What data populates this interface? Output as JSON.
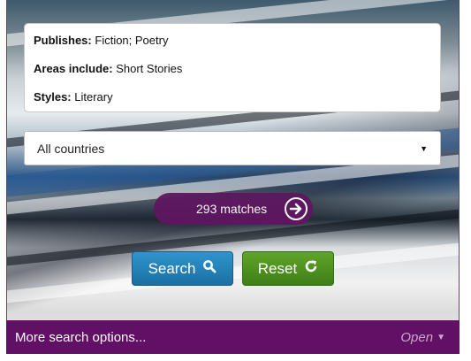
{
  "filters": {
    "publishes_label": "Publishes:",
    "publishes_value": "Fiction; Poetry",
    "areas_label": "Areas include:",
    "areas_value": "Short Stories",
    "styles_label": "Styles:",
    "styles_value": "Literary"
  },
  "country_select": {
    "value": "All countries",
    "icon": "chevron-down-icon"
  },
  "matches": {
    "label": "293 matches",
    "icon": "arrow-right-circle-icon"
  },
  "buttons": {
    "search_label": "Search",
    "search_icon": "search-icon",
    "reset_label": "Reset",
    "reset_icon": "refresh-icon"
  },
  "footer": {
    "more_options": "More search options...",
    "open_label": "Open"
  },
  "colors": {
    "footer_bg": "#620f66",
    "matches_bg": "#5e1760",
    "search_btn": "#1a6fa3",
    "reset_btn": "#3f7e17"
  }
}
